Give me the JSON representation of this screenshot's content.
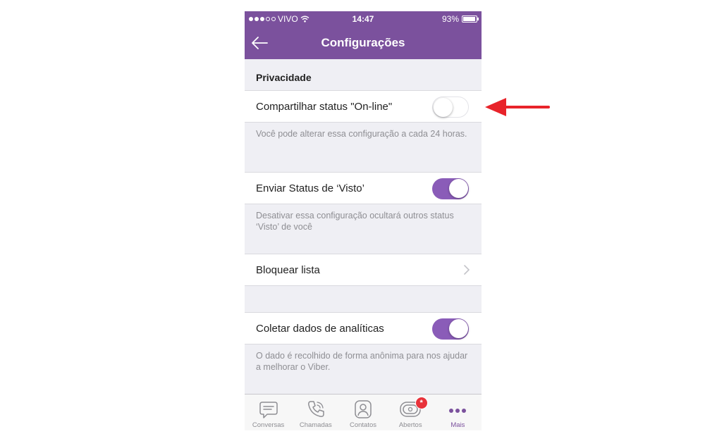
{
  "status_bar": {
    "carrier": "VIVO",
    "time": "14:47",
    "battery": "93%",
    "battery_level": 0.93,
    "signal_bars": 3
  },
  "nav": {
    "title": "Configurações",
    "back_icon": "back-arrow-icon"
  },
  "section": {
    "title": "Privacidade"
  },
  "settings": [
    {
      "label": "Compartilhar status \"On-line\"",
      "control": "toggle",
      "on": false,
      "footnote": "Você pode alterar essa configuração a cada 24 horas."
    },
    {
      "label": "Enviar Status de ‘Visto’",
      "control": "toggle",
      "on": true,
      "footnote": "Desativar essa configuração ocultará outros status ‘Visto’ de você"
    },
    {
      "label": "Bloquear lista",
      "control": "chevron"
    },
    {
      "label": "Coletar dados de analíticas",
      "control": "toggle",
      "on": true,
      "footnote": "O dado é recolhido de forma anônima para nos ajudar a melhorar o Viber."
    }
  ],
  "tabs": [
    {
      "label": "Conversas",
      "icon": "chat-bubble-icon"
    },
    {
      "label": "Chamadas",
      "icon": "phone-icon"
    },
    {
      "label": "Contatos",
      "icon": "contact-icon"
    },
    {
      "label": "Abertos",
      "icon": "public-chats-icon",
      "badge": "*"
    },
    {
      "label": "Mais",
      "icon": "more-dots-icon",
      "active": true
    }
  ],
  "colors": {
    "brand": "#7b519d",
    "toggle_on": "#8a5cb8",
    "annotation_arrow": "#e8232a",
    "badge": "#e8323a"
  }
}
